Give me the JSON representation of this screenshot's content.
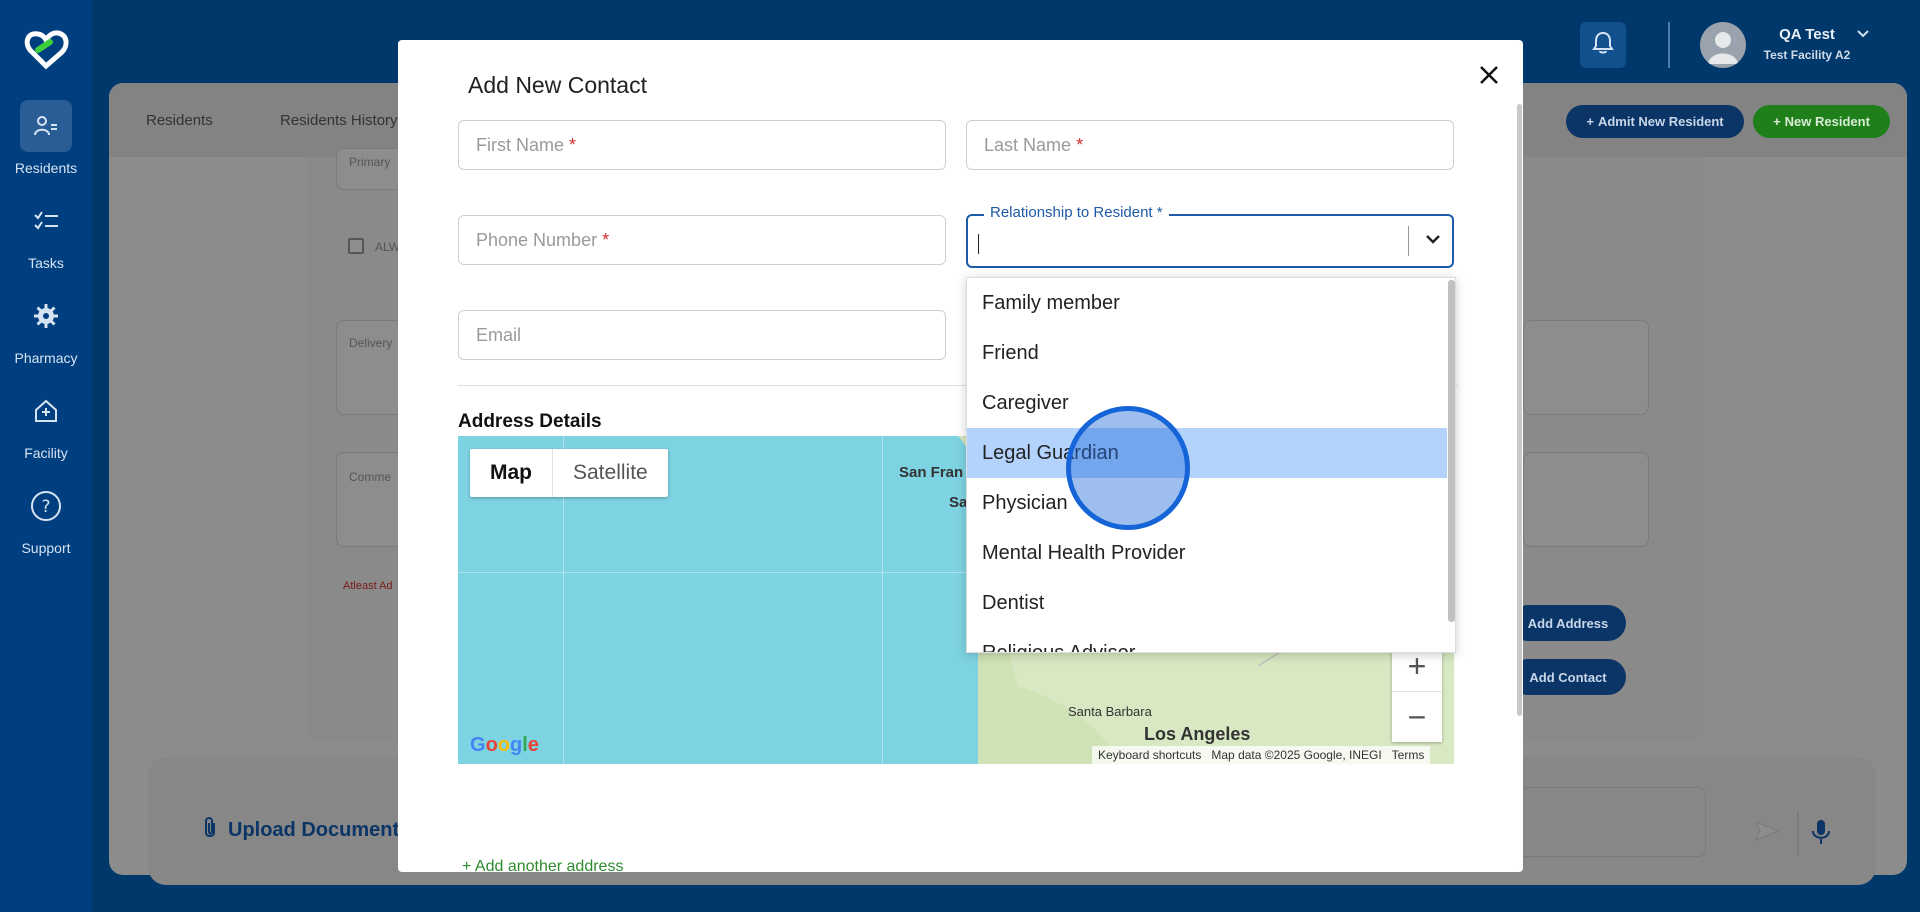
{
  "nav": {
    "items": [
      {
        "label": "Residents",
        "icon": "residents-icon"
      },
      {
        "label": "Tasks",
        "icon": "tasks-icon"
      },
      {
        "label": "Pharmacy",
        "icon": "gear-icon"
      },
      {
        "label": "Facility",
        "icon": "facility-icon"
      },
      {
        "label": "Support",
        "icon": "help-icon"
      }
    ]
  },
  "topbar": {
    "user_name": "QA Test",
    "facility": "Test Facility A2"
  },
  "background": {
    "tabs": [
      "Residents",
      "Residents History"
    ],
    "field_primary": "Primary",
    "checkbox_label": "ALW",
    "field_delivery": "Delivery",
    "field_comments": "Comme",
    "warning": "Atleast Ad",
    "admit_button": "Admit New Resident",
    "new_resident_button": "New Resident",
    "add_address_button": "Add Address",
    "add_contact_button": "Add Contact",
    "upload_label": "Upload Document/"
  },
  "modal": {
    "title": "Add New Contact",
    "first_name_placeholder": "First Name",
    "last_name_placeholder": "Last Name",
    "phone_placeholder": "Phone Number",
    "relationship_label": "Relationship to Resident *",
    "email_placeholder": "Email",
    "required_mark": "*",
    "address_section_title": "Address Details",
    "add_another_address": "+ Add another address"
  },
  "map": {
    "type_map": "Map",
    "type_satellite": "Satellite",
    "cities": [
      "San Fran",
      "Sa",
      "Santa Barbara",
      "Los Angeles"
    ],
    "zoom_in": "+",
    "zoom_out": "−",
    "google": "Google",
    "keyboard_shortcuts": "Keyboard shortcuts",
    "map_data": "Map data ©2025 Google, INEGI",
    "terms": "Terms"
  },
  "dropdown": {
    "options": [
      "Family member",
      "Friend",
      "Caregiver",
      "Legal Guardian",
      "Physician",
      "Mental Health Provider",
      "Dentist",
      "Religious Advisor"
    ],
    "highlighted": "Legal Guardian"
  },
  "colors": {
    "primary": "#003f7f",
    "accent_blue": "#1f5aa6",
    "green": "#2e8b2e",
    "highlight": "#b3d3fd"
  }
}
